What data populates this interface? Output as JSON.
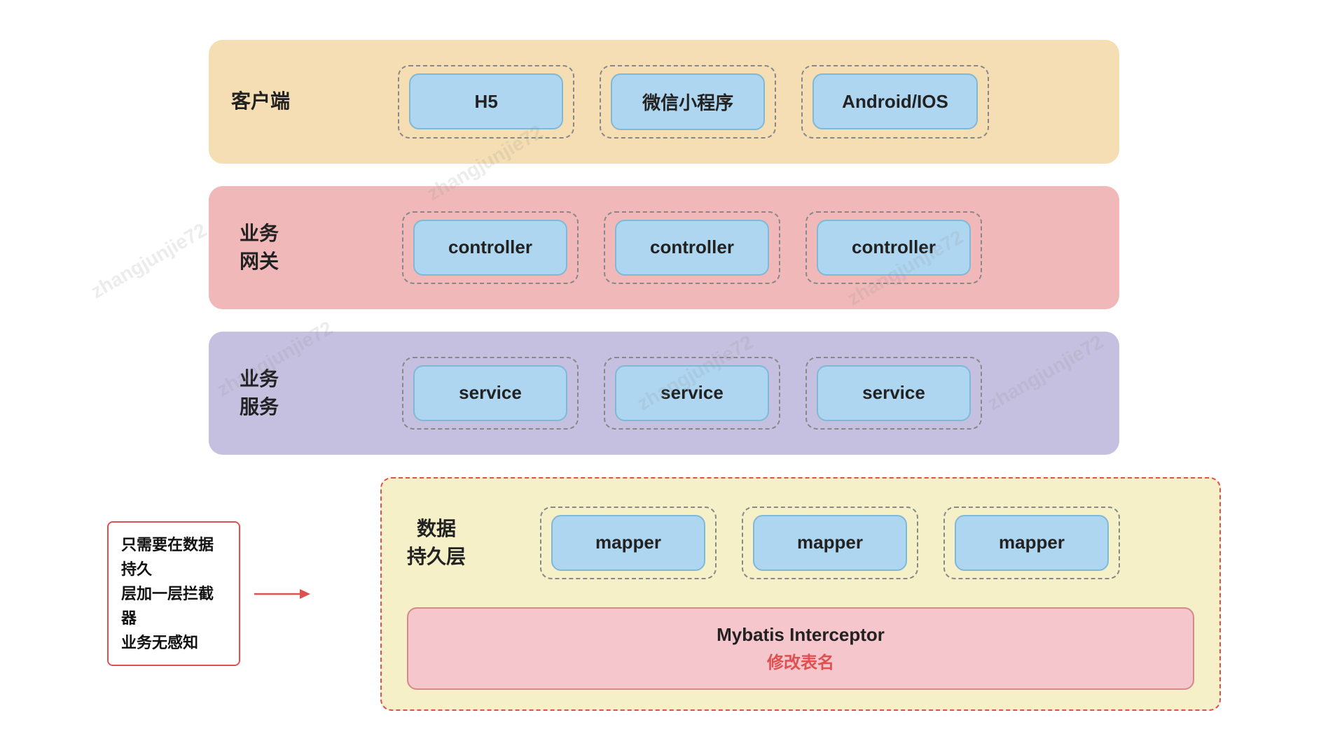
{
  "watermarks": [
    "zhangjunjie72",
    "zhangjunjie72",
    "zhangjunjie72",
    "zhangjunjie72",
    "zhangjunjie72",
    "zhangjunjie72"
  ],
  "layers": {
    "client": {
      "label": "客户端",
      "boxes": [
        "H5",
        "微信小程序",
        "Android/IOS"
      ]
    },
    "gateway": {
      "label": "业务\n网关",
      "boxes": [
        "controller",
        "controller",
        "controller"
      ]
    },
    "service": {
      "label": "业务\n服务",
      "boxes": [
        "service",
        "service",
        "service"
      ]
    },
    "data": {
      "label": "数据\n持久层",
      "mappers": [
        "mapper",
        "mapper",
        "mapper"
      ],
      "interceptor_title": "Mybatis Interceptor",
      "interceptor_subtitle": "修改表名"
    }
  },
  "annotation": {
    "text": "只需要在数据持久\n层加一层拦截器\n业务无感知",
    "arrow": "→"
  }
}
